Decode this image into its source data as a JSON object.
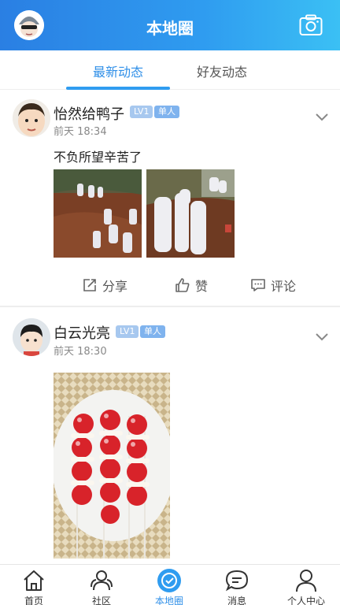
{
  "header": {
    "title": "本地圈"
  },
  "tabs": [
    {
      "label": "最新动态"
    },
    {
      "label": "好友动态"
    }
  ],
  "posts": [
    {
      "username": "怡然给鸭子",
      "level": "LV1",
      "tag": "单人",
      "time": "前天 18:34",
      "text": "不负所望辛苦了"
    },
    {
      "username": "白云光亮",
      "level": "LV1",
      "tag": "单人",
      "time": "前天 18:30",
      "text": ""
    }
  ],
  "actions": {
    "share": "分享",
    "like": "赞",
    "comment": "评论"
  },
  "nav": [
    {
      "label": "首页",
      "icon": "home-icon"
    },
    {
      "label": "社区",
      "icon": "community-icon"
    },
    {
      "label": "本地圈",
      "icon": "local-circle-icon"
    },
    {
      "label": "消息",
      "icon": "message-icon"
    },
    {
      "label": "个人中心",
      "icon": "profile-icon"
    }
  ],
  "colors": {
    "accent": "#2f8fe8",
    "header_start": "#2a7fe3",
    "header_end": "#3bc0f4"
  }
}
